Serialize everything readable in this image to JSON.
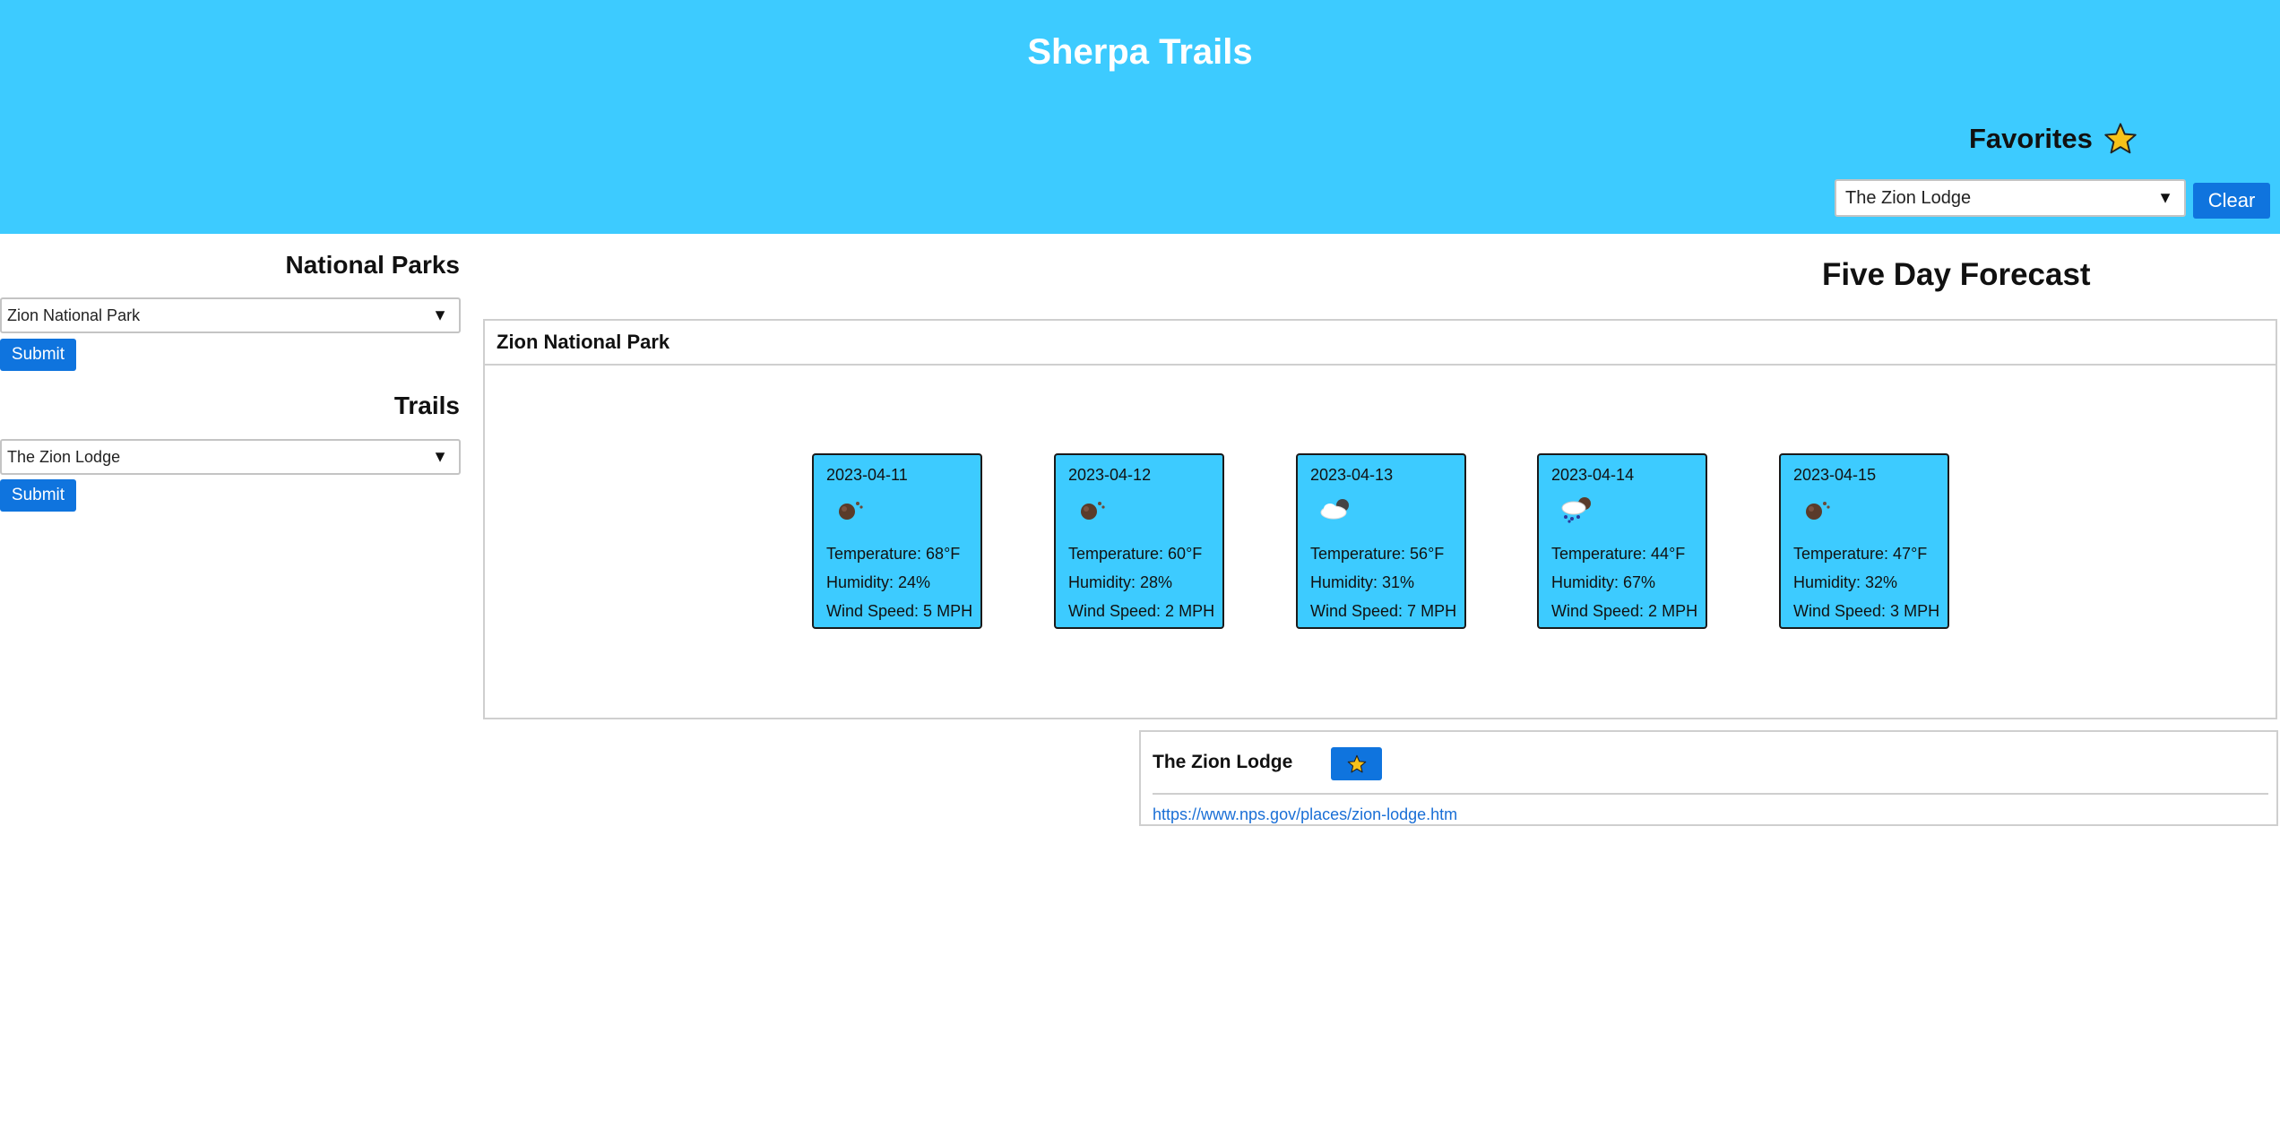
{
  "header": {
    "title": "Sherpa Trails",
    "favorites_label": "Favorites",
    "favorites_selected": "The Zion Lodge",
    "clear_label": "Clear"
  },
  "sidebar": {
    "parks_title": "National Parks",
    "park_selected": "Zion National Park",
    "parks_submit_label": "Submit",
    "trails_title": "Trails",
    "trail_selected": "The Zion Lodge",
    "trails_submit_label": "Submit"
  },
  "forecast": {
    "title": "Five Day Forecast",
    "park_name": "Zion National Park",
    "days": [
      {
        "date": "2023-04-11",
        "icon": "dust-icon",
        "temperature": "Temperature: 68°F",
        "humidity": "Humidity: 24%",
        "wind": "Wind Speed: 5 MPH"
      },
      {
        "date": "2023-04-12",
        "icon": "dust-icon",
        "temperature": "Temperature: 60°F",
        "humidity": "Humidity: 28%",
        "wind": "Wind Speed: 2 MPH"
      },
      {
        "date": "2023-04-13",
        "icon": "partly-cloudy-icon",
        "temperature": "Temperature: 56°F",
        "humidity": "Humidity: 31%",
        "wind": "Wind Speed: 7 MPH"
      },
      {
        "date": "2023-04-14",
        "icon": "rain-cloud-icon",
        "temperature": "Temperature: 44°F",
        "humidity": "Humidity: 67%",
        "wind": "Wind Speed: 2 MPH"
      },
      {
        "date": "2023-04-15",
        "icon": "dust-icon",
        "temperature": "Temperature: 47°F",
        "humidity": "Humidity: 32%",
        "wind": "Wind Speed: 3 MPH"
      }
    ]
  },
  "trail_card": {
    "name": "The Zion Lodge",
    "link": "https://www.nps.gov/places/zion-lodge.htm"
  },
  "colors": {
    "header_bg": "#3dcbff",
    "button_blue": "#0f74de",
    "star_yellow": "#f7c21a",
    "link_blue": "#1a6fd6"
  }
}
